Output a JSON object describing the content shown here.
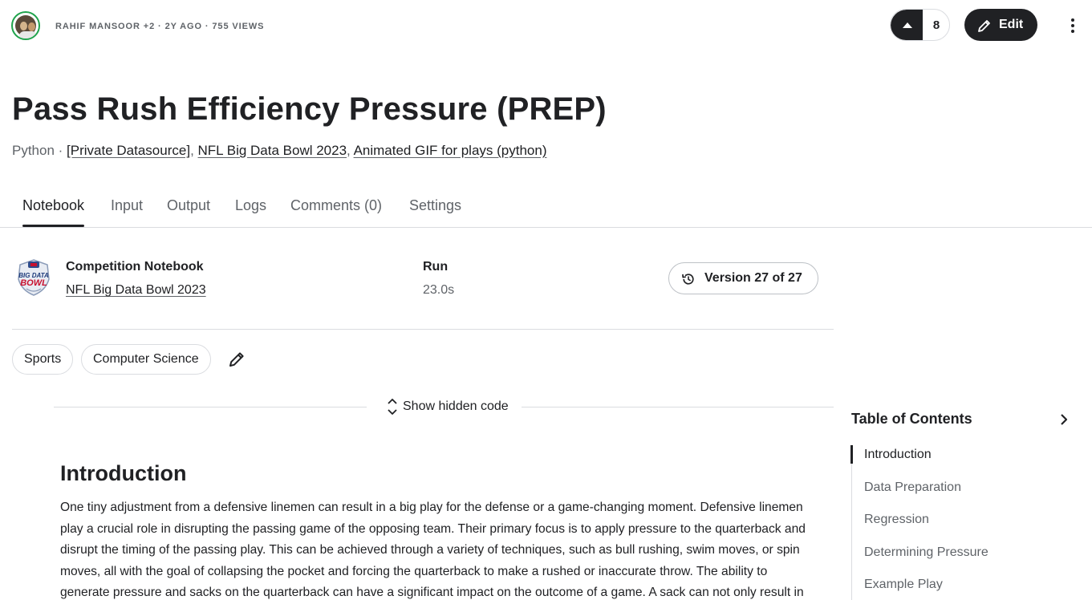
{
  "header": {
    "byline": "RAHIF MANSOOR +2 · 2Y AGO · 755 VIEWS",
    "vote_count": "8",
    "edit_label": "Edit"
  },
  "notebook": {
    "title": "Pass Rush Efficiency Pressure (PREP)",
    "language": "Python",
    "separator": " · ",
    "sources": [
      "[Private Datasource]",
      "NFL Big Data Bowl 2023",
      "Animated GIF for plays (python)"
    ]
  },
  "tabs": [
    {
      "label": "Notebook",
      "active": true
    },
    {
      "label": "Input",
      "active": false
    },
    {
      "label": "Output",
      "active": false
    },
    {
      "label": "Logs",
      "active": false
    },
    {
      "label": "Comments (0)",
      "active": false
    },
    {
      "label": "Settings",
      "active": false
    }
  ],
  "competition": {
    "heading": "Competition Notebook",
    "name": "NFL Big Data Bowl 2023",
    "logo_text": [
      "BIG DATA",
      "BOWL"
    ]
  },
  "run": {
    "heading": "Run",
    "duration": "23.0s"
  },
  "version": {
    "label": "Version 27 of 27"
  },
  "tags": [
    "Sports",
    "Computer Science"
  ],
  "hidden_code": {
    "label": "Show hidden code"
  },
  "content": {
    "heading": "Introduction",
    "paragraph": "One tiny adjustment from a defensive linemen can result in a big play for the defense or a game-changing moment. Defensive linemen play a crucial role in disrupting the passing game of the opposing team. Their primary focus is to apply pressure to the quarterback and disrupt the timing of the passing play. This can be achieved through a variety of techniques, such as bull rushing, swim moves, or spin moves, all with the goal of collapsing the pocket and forcing the quarterback to make a rushed or inaccurate throw. The ability to generate pressure and sacks on the quarterback can have a significant impact on the outcome of a game. A sack can not only result in"
  },
  "toc": {
    "title": "Table of Contents",
    "items": [
      {
        "label": "Introduction",
        "active": true
      },
      {
        "label": "Data Preparation",
        "active": false
      },
      {
        "label": "Regression",
        "active": false
      },
      {
        "label": "Determining Pressure",
        "active": false
      },
      {
        "label": "Example Play",
        "active": false
      }
    ]
  },
  "colors": {
    "accent_dark": "#202124",
    "muted_text": "#5f6368",
    "border": "#dadce0",
    "avatar_ring": "#20a34c"
  }
}
